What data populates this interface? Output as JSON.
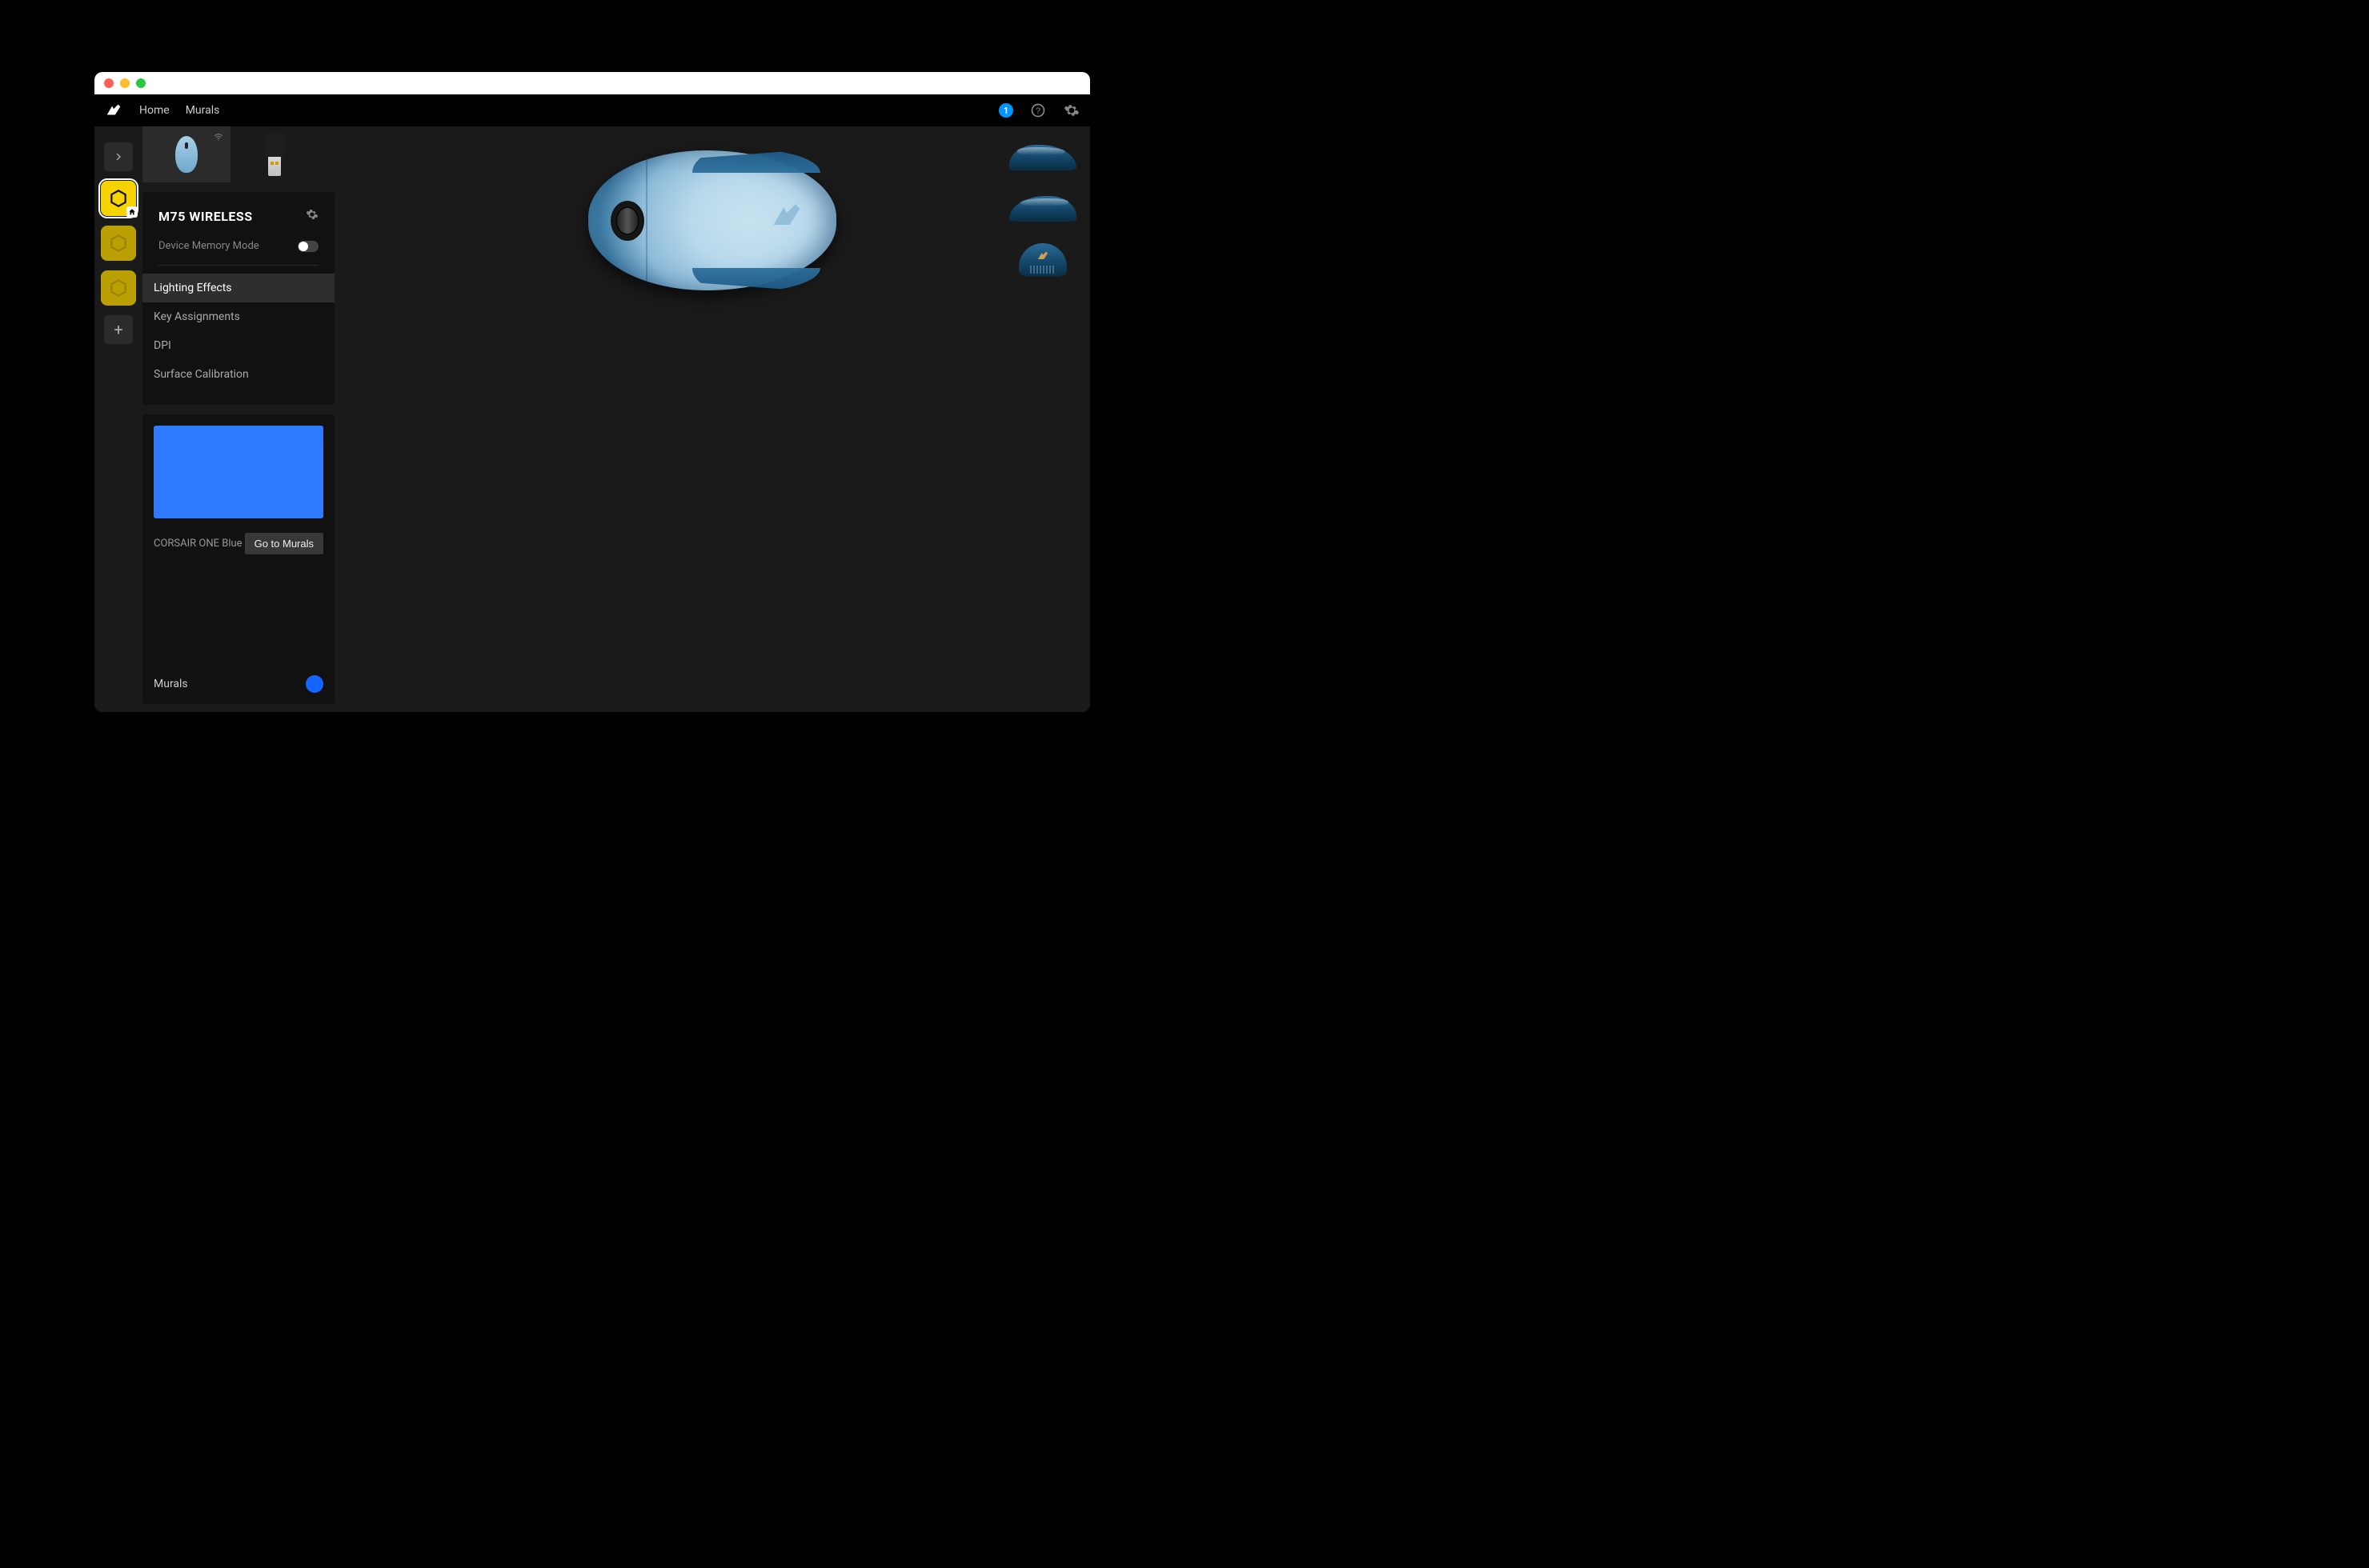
{
  "nav": {
    "home": "Home",
    "murals": "Murals"
  },
  "notifications": {
    "count": "1"
  },
  "sidebar": {
    "profiles": [
      {
        "name": "profile-1",
        "active": true
      },
      {
        "name": "profile-2",
        "active": false
      },
      {
        "name": "profile-3",
        "active": false
      }
    ]
  },
  "device_tabs": [
    {
      "name": "M75 Wireless Mouse",
      "icon": "mouse-icon",
      "active": true,
      "wireless": true
    },
    {
      "name": "USB Receiver",
      "icon": "dongle-icon",
      "active": false,
      "wireless": false
    }
  ],
  "device": {
    "title": "M75 WIRELESS",
    "memory_mode_label": "Device Memory Mode",
    "memory_mode_on": false,
    "menu": [
      {
        "label": "Lighting Effects",
        "selected": true
      },
      {
        "label": "Key Assignments",
        "selected": false
      },
      {
        "label": "DPI",
        "selected": false
      },
      {
        "label": "Surface Calibration",
        "selected": false
      }
    ]
  },
  "effect": {
    "preview_color": "#2f7bff",
    "preset_name": "CORSAIR ONE Blue",
    "go_to_murals": "Go to Murals",
    "footer_label": "Murals",
    "footer_color": "#1565ff"
  },
  "views": [
    {
      "name": "side-left-view"
    },
    {
      "name": "side-right-view"
    },
    {
      "name": "rear-view"
    }
  ]
}
